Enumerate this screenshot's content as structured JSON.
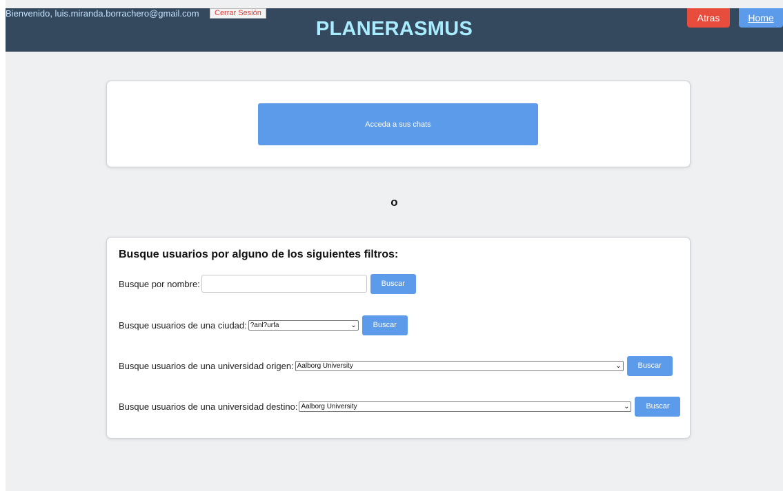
{
  "header": {
    "welcome_text": "Bienvenido, luis.miranda.borrachero@gmail.com",
    "logout_label": "Cerrar Sesión",
    "site_title": "PLANERASMUS",
    "back_label": "Atras",
    "home_label": "Home"
  },
  "chats": {
    "button_label": "Acceda a sus chats"
  },
  "separator": "o",
  "filters": {
    "heading": "Busque usuarios por alguno de los siguientes filtros:",
    "name_label": "Busque por nombre:",
    "name_value": "",
    "city_label": "Busque usuarios de una ciudad:",
    "city_selected": "?anl?urfa",
    "origin_label": "Busque usuarios de una universidad origen:",
    "origin_selected": "Aalborg University",
    "dest_label": "Busque usuarios de una universidad destino:",
    "dest_selected": "Aalborg University",
    "search_label": "Buscar"
  },
  "colors": {
    "header_bg": "#34495e",
    "title": "#a9ecff",
    "back_button": "#e74c3c",
    "primary_button": "#5b9bea",
    "page_bg": "#eef0f2"
  },
  "icons": {
    "select_arrow": "chevron-down-icon"
  }
}
